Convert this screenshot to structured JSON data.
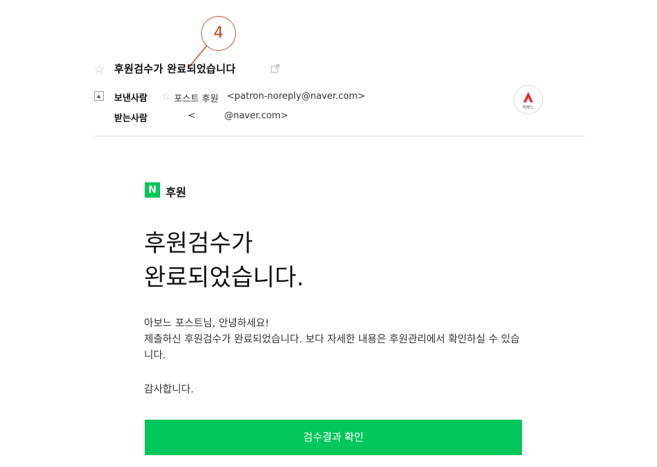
{
  "annotation": {
    "step_number": "4"
  },
  "email": {
    "subject": "후원검수가 완료되었습니다",
    "sender_label": "보낸사람",
    "sender_name": "포스트 후원",
    "sender_email": "<patron-noreply@naver.com>",
    "recipient_label": "받는사람",
    "recipient_value": "<          @naver.com>",
    "avatar_caption": "아보느"
  },
  "content": {
    "brand_mark": "N",
    "brand_name": "후원",
    "headline_line1": "후원검수가",
    "headline_line2": "완료되었습니다.",
    "greeting": "아보느 포스트님, 안녕하세요!",
    "body": "제출하신 후원검수가 완료되었습니다. 보다 자세한 내용은 후원관리에서 확인하실 수 있습니다.",
    "thanks": "감사합니다.",
    "cta_label": "검수결과 확인"
  },
  "colors": {
    "brand_green": "#03c75a",
    "annotation": "#c0562a"
  }
}
